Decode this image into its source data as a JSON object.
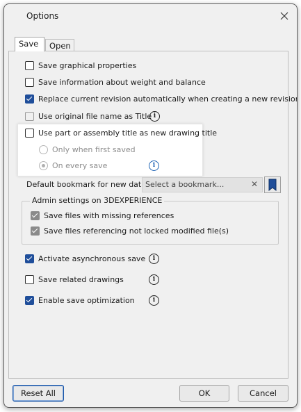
{
  "window": {
    "title": "Options"
  },
  "tabs": {
    "save_label": "Save",
    "open_label": "Open"
  },
  "save_options": {
    "graphical": {
      "label": "Save graphical properties",
      "checked": false
    },
    "weight_balance": {
      "label": "Save information about weight and balance",
      "checked": false
    },
    "replace_revision": {
      "label": "Replace current revision automatically when creating a new revision",
      "checked": true
    },
    "original_filename": {
      "label": "Use original file name as Title",
      "checked": false
    },
    "part_title": {
      "label": "Use part or assembly title as new drawing title",
      "checked": false
    },
    "only_first_saved": {
      "label": "Only when first saved",
      "selected": false
    },
    "every_save": {
      "label": "On every save",
      "selected": true
    }
  },
  "bookmark": {
    "label": "Default bookmark for new data:",
    "placeholder": "Select a bookmark...",
    "clear_glyph": "✕"
  },
  "admin": {
    "title": "Admin settings on 3DEXPERIENCE",
    "missing_refs": {
      "label": "Save files with missing references",
      "checked": true
    },
    "not_locked": {
      "label": "Save files referencing not locked modified file(s)",
      "checked": true
    }
  },
  "more_options": {
    "async_save": {
      "label": "Activate asynchronous save",
      "checked": true
    },
    "related_drawings": {
      "label": "Save related drawings",
      "checked": false
    },
    "save_optimization": {
      "label": "Enable save optimization",
      "checked": true
    }
  },
  "info_glyph": "i",
  "buttons": {
    "reset": "Reset All",
    "ok": "OK",
    "cancel": "Cancel"
  },
  "colors": {
    "accent": "#1f4e9a",
    "info_blue": "#1e63b5"
  },
  "icons": {
    "close": "close-icon",
    "info": "info-icon",
    "bookmark": "bookmark-icon",
    "clear": "clear-icon"
  }
}
